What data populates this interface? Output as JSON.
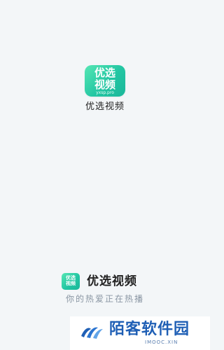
{
  "splash": {
    "logo": {
      "line1": "优选",
      "line2": "视频",
      "domain": "yxsp.pro"
    },
    "title": "优选视频"
  },
  "bottom": {
    "logo": {
      "line1": "优选",
      "line2": "视频"
    },
    "title": "优选视频",
    "slogan": "你的热爱正在热播"
  },
  "watermark": {
    "text": "陌客软件园",
    "sub": "IMOOC.XIN",
    "icon": "watermark-logo-icon"
  },
  "colors": {
    "background": "#f3f6f8",
    "logo_gradient_start": "#56e7b4",
    "logo_gradient_end": "#1ab79a",
    "slogan": "#8a96a3",
    "watermark_blue": "#1f5fb5"
  }
}
